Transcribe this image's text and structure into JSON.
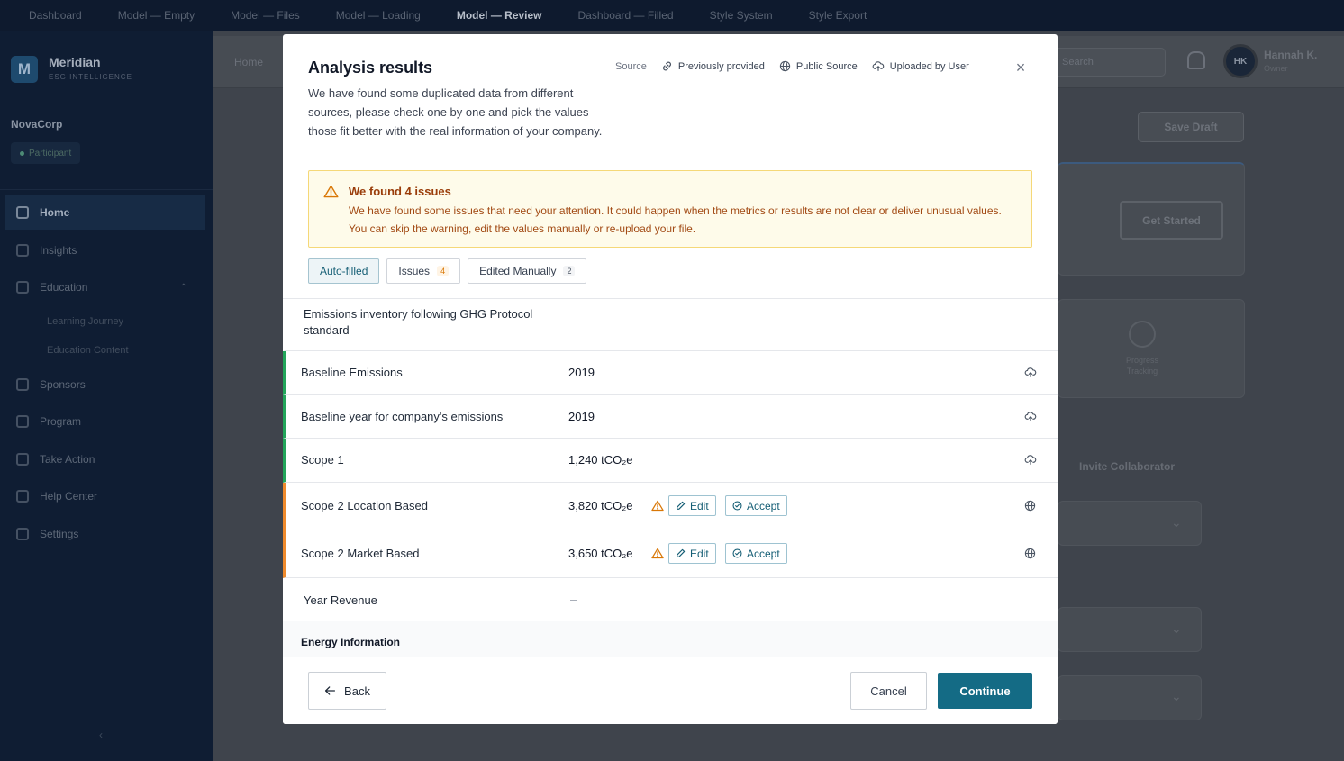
{
  "topnav": {
    "items": [
      "Dashboard",
      "Model — Empty",
      "Model — Files",
      "Model — Loading",
      "Model — Review",
      "Dashboard — Filled",
      "Style System",
      "Style Export"
    ],
    "active_index": 4
  },
  "sidebar": {
    "logo_letter": "M",
    "brand": "Meridian",
    "brand_sub": "ESG INTELLIGENCE",
    "org": "NovaCorp",
    "role": "Participant",
    "items": [
      {
        "label": "Home",
        "icon": "home-icon",
        "active": true
      },
      {
        "label": "Insights",
        "icon": "chart-icon"
      },
      {
        "label": "Education",
        "icon": "book-icon"
      },
      {
        "label": "Sponsors",
        "icon": "users-icon"
      },
      {
        "label": "Program",
        "icon": "grid-icon"
      },
      {
        "label": "Take Action",
        "icon": "target-icon"
      },
      {
        "label": "Help Center",
        "icon": "help-icon"
      },
      {
        "label": "Settings",
        "icon": "gear-icon"
      }
    ],
    "sub_items": [
      "Learning Journey",
      "Education Content"
    ],
    "collapse": "‹"
  },
  "header": {
    "breadcrumb": "Home",
    "search_placeholder": "Search",
    "user_initials": "HK",
    "user_name": "Hannah K.",
    "user_role": "Owner"
  },
  "background": {
    "save_draft": "Save Draft",
    "get_started": "Get Started",
    "progress_label": "Progress Tracking",
    "invite": "Invite Collaborator"
  },
  "modal": {
    "title": "Analysis results",
    "description": "We have found some duplicated data from different sources, please check one by one and pick the values those fit better with the real information of your company.",
    "source_label": "Source",
    "sources": [
      {
        "label": "Previously provided",
        "icon": "link-icon"
      },
      {
        "label": "Public Source",
        "icon": "globe-icon"
      },
      {
        "label": "Uploaded by User",
        "icon": "cloud-upload-icon"
      }
    ],
    "close": "×",
    "alert": {
      "title": "We found 4 issues",
      "text": "We have found some issues that need your attention. It could happen when the metrics or results are not clear or deliver unusual values. You can skip the warning, edit the values manually or re-upload your file."
    },
    "tabs": [
      {
        "label": "Auto-filled",
        "count": "",
        "active": true
      },
      {
        "label": "Issues",
        "count": "4"
      },
      {
        "label": "Edited Manually",
        "count": "2"
      }
    ],
    "rows": [
      {
        "label": "Emissions inventory following GHG Protocol standard",
        "value": "–",
        "status": "none",
        "source": ""
      },
      {
        "label": "Baseline Emissions",
        "value": "2019",
        "status": "ok",
        "source": "cloud-upload-icon"
      },
      {
        "label": "Baseline year for company's emissions",
        "value": "2019",
        "status": "ok",
        "source": "cloud-upload-icon"
      },
      {
        "label": "Scope 1",
        "value": "1,240 tCO₂e",
        "status": "ok",
        "source": "cloud-upload-icon"
      },
      {
        "label": "Scope 2 Location Based",
        "value": "3,820 tCO₂e",
        "status": "warn",
        "source": "globe-icon"
      },
      {
        "label": "Scope 2 Market Based",
        "value": "3,650 tCO₂e",
        "status": "warn",
        "source": "globe-icon"
      },
      {
        "label": "Year Revenue",
        "value": "–",
        "status": "none",
        "source": ""
      }
    ],
    "edit_label": "Edit",
    "accept_label": "Accept",
    "section_heading": "Energy Information",
    "back_label": "Back",
    "cancel_label": "Cancel",
    "continue_label": "Continue"
  },
  "colors": {
    "accent": "#146b85",
    "ok_border": "#22a55a",
    "warn_border": "#ef8a2c",
    "alert_bg": "#fefbea",
    "alert_text": "#9a3d0a"
  }
}
